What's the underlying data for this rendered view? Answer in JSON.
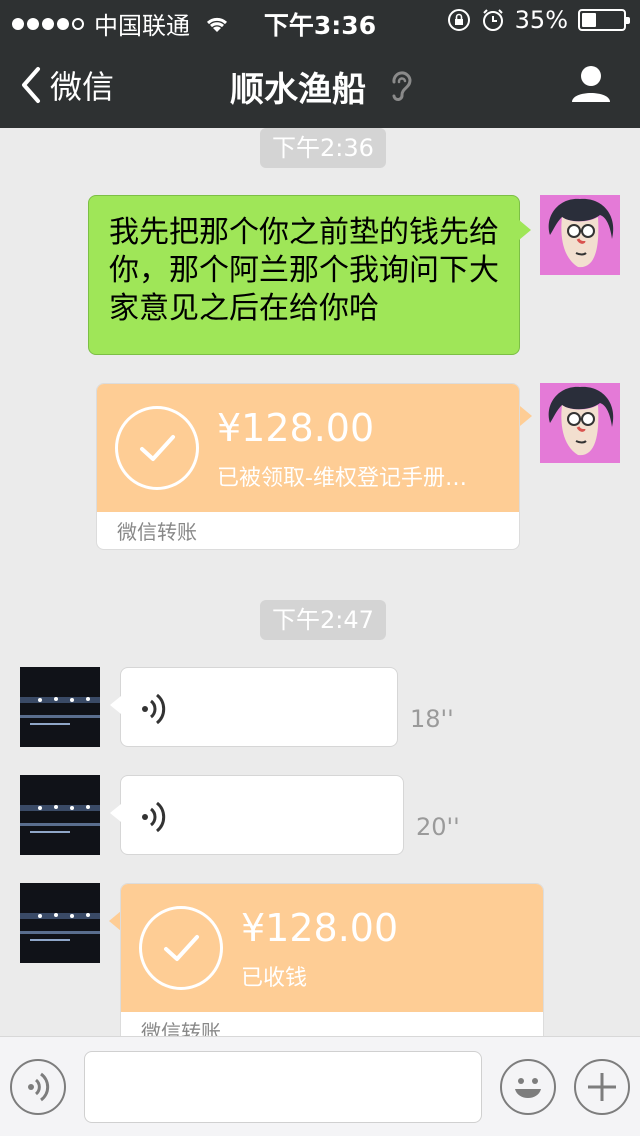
{
  "status_bar": {
    "carrier": "中国联通",
    "time": "下午3:36",
    "battery": "35%",
    "battery_level": 0.35
  },
  "nav": {
    "back_label": "微信",
    "title": "顺水渔船"
  },
  "messages": {
    "ts1": "下午2:36",
    "text1": "我先把那个你之前垫的钱先给你，那个阿兰那个我询问下大家意见之后在给你哈",
    "transfer1": {
      "amount": "¥128.00",
      "status": "已被领取-维权登记手册…",
      "footer": "微信转账"
    },
    "ts2": "下午2:47",
    "voice1_duration": "18''",
    "voice2_duration": "20''",
    "transfer2": {
      "amount": "¥128.00",
      "status": "已收钱",
      "footer": "微信转账"
    }
  },
  "colors": {
    "nav_bg": "#2e3132",
    "chat_bg": "#ebebeb",
    "green_bubble": "#9fe658",
    "transfer_orange": "#fecd95"
  },
  "icons": [
    "signal-dots-icon",
    "wifi-icon",
    "rotation-lock-icon",
    "alarm-icon",
    "battery-icon",
    "back-chevron-icon",
    "ear-icon",
    "profile-icon",
    "check-icon",
    "voice-wave-icon",
    "emoji-icon",
    "plus-icon"
  ]
}
